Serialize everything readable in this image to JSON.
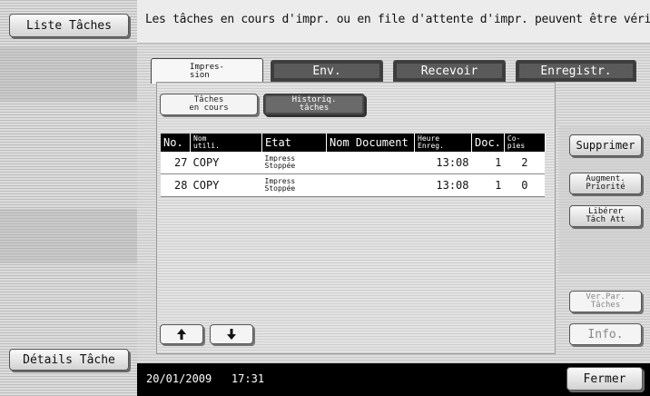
{
  "left": {
    "job_list_label": "Liste Tâches",
    "job_details_label": "Détails Tâche"
  },
  "header": {
    "message": "Les tâches en cours d'impr. ou en file d'attente d'impr. peuvent être vérif."
  },
  "tabs": [
    {
      "label": "Impres-\nsion",
      "active": true
    },
    {
      "label": "Env.",
      "active": false
    },
    {
      "label": "Recevoir",
      "active": false
    },
    {
      "label": "Enregistr.",
      "active": false
    }
  ],
  "subtabs": {
    "current_label": "Tâches\nen cours",
    "history_label": "Historiq.\ntâches"
  },
  "table": {
    "headers": [
      "No.",
      "Nom\nutili.",
      "Etat",
      "Nom Document",
      "Heure\nEnreg.",
      "Doc.",
      "Co-\npies"
    ],
    "rows": [
      {
        "no": "27",
        "user": "COPY",
        "status": "Impress\nStoppée",
        "document": "",
        "time": "13:08",
        "doc": "1",
        "copies": "2"
      },
      {
        "no": "28",
        "user": "COPY",
        "status": "Impress\nStoppée",
        "document": "",
        "time": "13:08",
        "doc": "1",
        "copies": "0"
      }
    ]
  },
  "actions": {
    "delete_label": "Supprimer",
    "raise_priority_label": "Augment.\nPriorité",
    "release_held_label": "Libérer\nTâch Att",
    "check_job_settings_label": "Ver.Par.\nTâches",
    "info_label": "Info.",
    "close_label": "Fermer"
  },
  "footer": {
    "datetime": "20/01/2009   17:31"
  },
  "icons": {
    "up": "arrow-up-icon",
    "down": "arrow-down-icon"
  }
}
